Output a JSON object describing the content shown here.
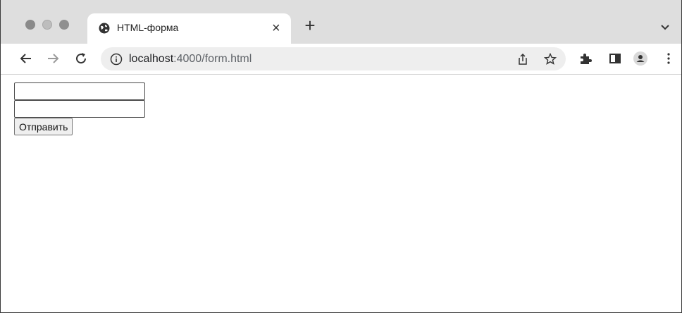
{
  "tab": {
    "title": "HTML-форма",
    "close_label": "×",
    "new_tab_label": "+"
  },
  "address_bar": {
    "host": "localhost",
    "rest": ":4000/form.html"
  },
  "icons": {
    "tab_favicon": "globe-icon",
    "back": "back-arrow-icon",
    "forward": "forward-arrow-icon",
    "reload": "reload-icon",
    "site_info": "info-icon",
    "share": "share-icon",
    "bookmark": "star-icon",
    "extensions": "puzzle-icon",
    "side_panel": "side-panel-icon",
    "profile": "profile-icon",
    "menu": "kebab-menu-icon",
    "tab_search": "chevron-down-icon"
  },
  "form": {
    "field1_value": "",
    "field2_value": "",
    "submit_label": "Отправить"
  }
}
